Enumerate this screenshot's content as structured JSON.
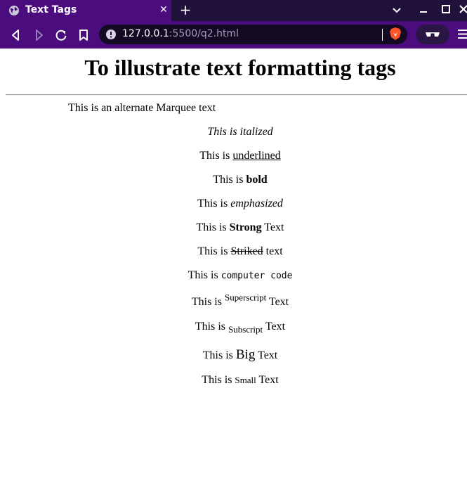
{
  "browser": {
    "tab": {
      "title": "Text Tags",
      "close_glyph": "✕"
    },
    "new_tab_glyph": "+",
    "address": {
      "host": "127.0.0.1",
      "rest": ":5500/q2.html"
    },
    "colors": {
      "tab_bg": "#4b0c7d",
      "titlebar_bg": "#20123a",
      "toolbar_bg": "#4b0c7d",
      "url_bg": "#140a24",
      "brave": "#fb542b"
    }
  },
  "page": {
    "title": "To illustrate text formatting tags",
    "marquee": "This is an alternate Marquee text",
    "italic": "This is italized",
    "underline_pre": "This is ",
    "underline_word": "underlined",
    "bold_pre": "This is ",
    "bold_word": "bold",
    "em_pre": "This is ",
    "em_word": "emphasized",
    "strong_pre": "This is ",
    "strong_word": "Strong",
    "strong_post": " Text",
    "strike_pre": "This is ",
    "strike_word": "Striked",
    "strike_post": " text",
    "code_pre": "This is ",
    "code_word": "computer code",
    "sup_pre": "This is ",
    "sup_word": "Superscript",
    "sup_post": " Text",
    "sub_pre": "This is ",
    "sub_word": "Subscript",
    "sub_post": " Text",
    "big_pre": "This is ",
    "big_word": "Big",
    "big_post": " Text",
    "small_pre": "This is ",
    "small_word": "Small",
    "small_post": " Text"
  }
}
